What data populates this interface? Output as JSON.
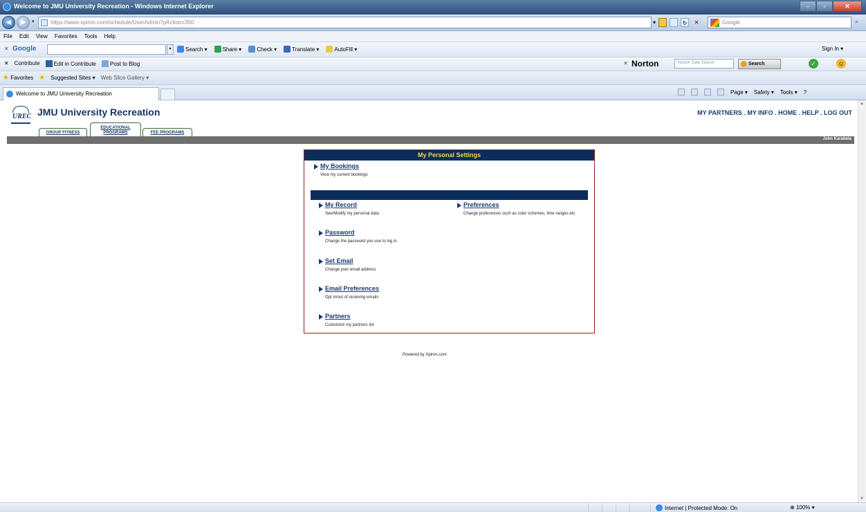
{
  "window": {
    "title": "Welcome to JMU University Recreation - Windows Internet Explorer"
  },
  "address_bar": {
    "url": "https://www.xpiron.com/schedule/UserAdmin?pAction=350",
    "search_placeholder": "Google"
  },
  "menu": {
    "items": [
      "File",
      "Edit",
      "View",
      "Favorites",
      "Tools",
      "Help"
    ]
  },
  "google_toolbar": {
    "logo": "Google",
    "tools": [
      "Search ▾",
      "Share ▾",
      "Check ▾",
      "Translate ▾",
      "AutoFill ▾"
    ],
    "sign_in": "Sign In ▾"
  },
  "contribute_toolbar": {
    "items": [
      "Contribute",
      "Edit in Contribute",
      "Post to Blog"
    ]
  },
  "norton_toolbar": {
    "logo": "Norton",
    "search_placeholder": "Norton Safe Search",
    "search_button": "Search"
  },
  "favorites_bar": {
    "favorites": "Favorites",
    "suggested": "Suggested Sites ▾",
    "web_slice": "Web Slice Gallery ▾"
  },
  "tabs": {
    "active": "Welcome to JMU University Recreation"
  },
  "command_bar": {
    "items": [
      "Page ▾",
      "Safety ▾",
      "Tools ▾"
    ]
  },
  "site": {
    "logo_text": "UREC",
    "title": "JMU University Recreation",
    "tabs": [
      "GROUP FITNESS",
      "EDUCATIONAL PROGRAMS",
      "FEE PROGRAMS"
    ],
    "top_nav": "MY PARTNERS . MY INFO . HOME . HELP . LOG OUT",
    "user_name": "John Karabela"
  },
  "settings": {
    "header": "My Personal Settings",
    "items": [
      {
        "label": "My Bookings",
        "desc": "View my current bookings"
      },
      {
        "label": "My Record",
        "desc": "See/Modify my personal data"
      },
      {
        "label": "Password",
        "desc": "Change the password you use to log in"
      },
      {
        "label": "Set Email",
        "desc": "Change your email address"
      },
      {
        "label": "Email Preferences",
        "desc": "Opt in/out of receiving emails"
      },
      {
        "label": "Partners",
        "desc": "Customize my partners list"
      },
      {
        "label": "Preferences",
        "desc": "Change preferences such as color schemes, time ranges etc"
      }
    ]
  },
  "footer": {
    "powered_by": "Powered by Xpiron.com"
  },
  "status_bar": {
    "zone": "Internet | Protected Mode: On",
    "zoom": "100%"
  }
}
